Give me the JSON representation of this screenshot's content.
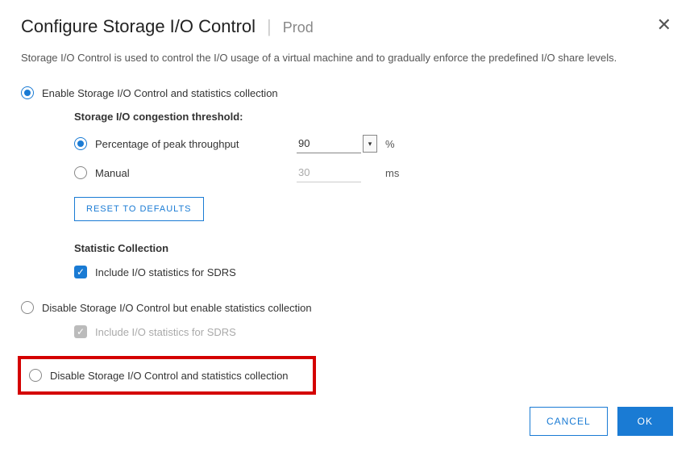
{
  "header": {
    "title": "Configure Storage I/O Control",
    "context": "Prod"
  },
  "description": "Storage I/O Control is used to control the I/O usage of a virtual machine and to gradually enforce the predefined I/O share levels.",
  "options": {
    "enable": {
      "label": "Enable Storage I/O Control and statistics collection",
      "congestion_heading": "Storage I/O congestion threshold:",
      "percentage": {
        "label": "Percentage of peak throughput",
        "value": "90",
        "unit": "%"
      },
      "manual": {
        "label": "Manual",
        "value": "30",
        "unit": "ms"
      },
      "reset_label": "RESET TO DEFAULTS",
      "stats_heading": "Statistic Collection",
      "include_stats_label": "Include I/O statistics for SDRS"
    },
    "disable_keep_stats": {
      "label": "Disable Storage I/O Control but enable statistics collection",
      "include_stats_label": "Include I/O statistics for SDRS"
    },
    "disable_all": {
      "label": "Disable Storage I/O Control and statistics collection"
    }
  },
  "footer": {
    "cancel": "CANCEL",
    "ok": "OK"
  }
}
